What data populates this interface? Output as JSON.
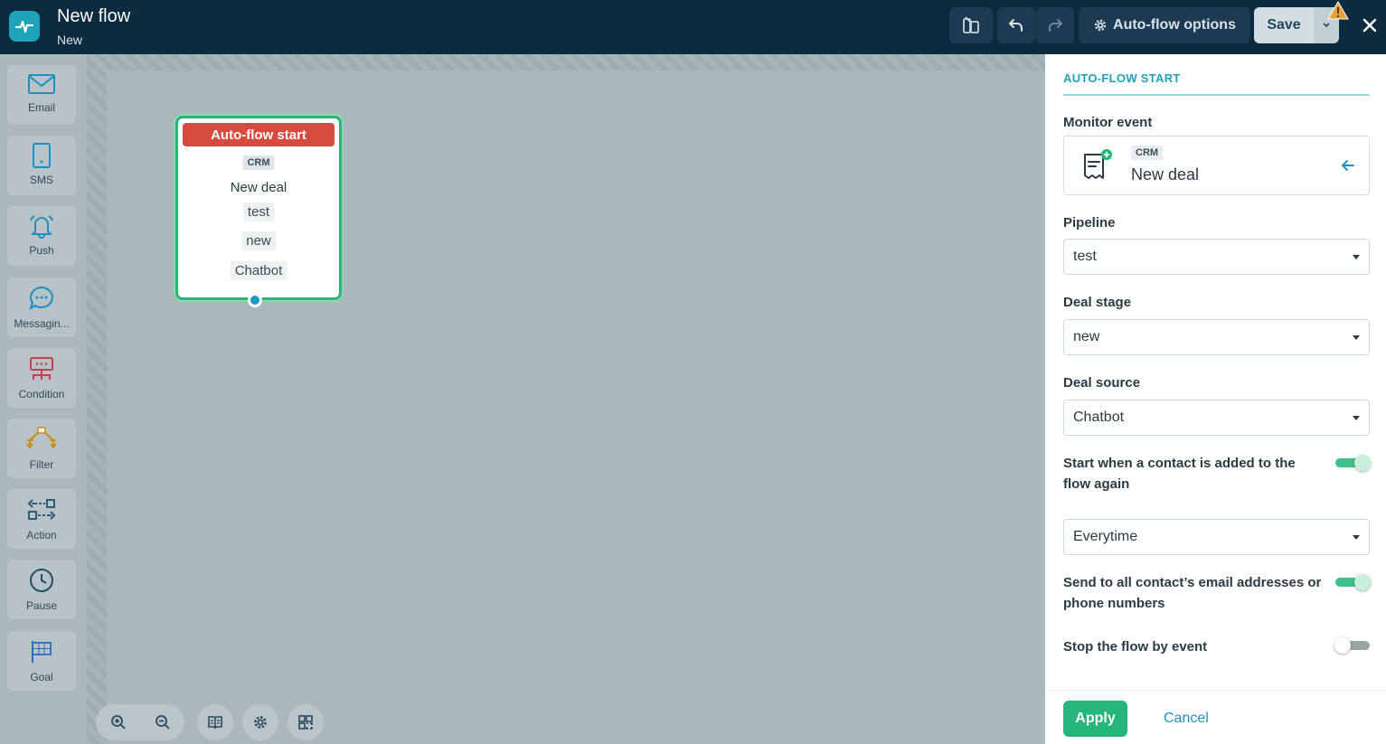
{
  "header": {
    "title": "New flow",
    "status": "New",
    "options_label": "Auto-flow options",
    "save_label": "Save"
  },
  "sidebar": {
    "items": [
      {
        "label": "Email",
        "icon": "envelope-icon",
        "color": "#1d8fc2"
      },
      {
        "label": "SMS",
        "icon": "phone-icon",
        "color": "#1d8fc2"
      },
      {
        "label": "Push",
        "icon": "bell-icon",
        "color": "#1d8fc2"
      },
      {
        "label": "Messagin...",
        "icon": "chat-bubble-icon",
        "color": "#1d8fc2"
      },
      {
        "label": "Condition",
        "icon": "condition-icon",
        "color": "#c8404c"
      },
      {
        "label": "Filter",
        "icon": "filter-icon",
        "color": "#c98d18"
      },
      {
        "label": "Action",
        "icon": "action-icon",
        "color": "#1d4f70"
      },
      {
        "label": "Pause",
        "icon": "clock-icon",
        "color": "#1d4f70"
      },
      {
        "label": "Goal",
        "icon": "flag-icon",
        "color": "#2a6fbd"
      }
    ]
  },
  "node": {
    "title": "Auto-flow start",
    "badge": "CRM",
    "event": "New deal",
    "pipeline": "test",
    "stage": "new",
    "source": "Chatbot"
  },
  "panel": {
    "heading": "AUTO-FLOW START",
    "monitor_label": "Monitor event",
    "event_badge": "CRM",
    "event_name": "New deal",
    "pipeline_label": "Pipeline",
    "pipeline_value": "test",
    "stage_label": "Deal stage",
    "stage_value": "new",
    "source_label": "Deal source",
    "source_value": "Chatbot",
    "readd_label": "Start when a contact is added to the flow again",
    "readd_on": true,
    "frequency_value": "Everytime",
    "send_all_label": "Send to all contact’s email addresses or phone numbers",
    "send_all_on": true,
    "stop_label": "Stop the flow by event",
    "stop_on": false,
    "apply_label": "Apply",
    "cancel_label": "Cancel"
  },
  "colors": {
    "topbar": "#0d2b3e",
    "accent": "#1fa3b8",
    "node_head": "#d64b3e",
    "node_border": "#2bb673",
    "apply": "#26b57a",
    "link": "#1d8fc2"
  }
}
